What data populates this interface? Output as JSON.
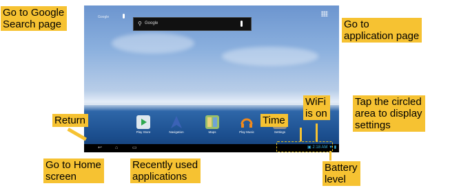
{
  "screen": {
    "google_label": "Google",
    "search": {
      "text": "Google",
      "icon": "search-icon",
      "mic": "microphone-icon"
    },
    "apps_icon": "apps-grid-icon",
    "dock": [
      {
        "label": "Play Store",
        "icon": "play-store-icon",
        "color": "#dfe8ee"
      },
      {
        "label": "Navigation",
        "icon": "navigation-icon",
        "color": "#3b62b6"
      },
      {
        "label": "Maps",
        "icon": "maps-icon",
        "color": "#9bc069"
      },
      {
        "label": "Play Music",
        "icon": "headphones-icon",
        "color": "#f28a1b"
      },
      {
        "label": "Settings",
        "icon": "settings-icon",
        "color": "#8e8e8e"
      }
    ],
    "status_time": "2:18 AM"
  },
  "callouts": {
    "google_search": "Go to Google\nSearch page",
    "app_page": "Go to\napplication page",
    "return": "Return",
    "home": "Go to Home\nscreen",
    "recent": "Recently used\napplications",
    "time": "Time",
    "wifi": "WiFi\nis on",
    "settings": "Tap the circled\narea to display\nsettings",
    "battery": "Battery\nlevel"
  },
  "colors": {
    "callout": "#f6c232",
    "status": "#35b3e5"
  }
}
